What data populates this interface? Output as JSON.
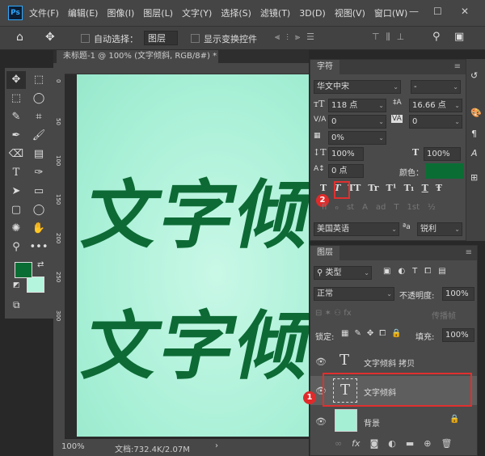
{
  "app": {
    "logo": "Ps"
  },
  "menu": [
    "文件(F)",
    "编辑(E)",
    "图像(I)",
    "图层(L)",
    "文字(Y)",
    "选择(S)",
    "滤镜(T)",
    "3D(D)",
    "视图(V)",
    "窗口(W)"
  ],
  "window_controls": {
    "minimize": "—",
    "maximize": "☐",
    "close": "✕"
  },
  "options": {
    "auto_select_label": "自动选择：",
    "auto_select_value": "图层",
    "show_transform_label": "显示变换控件"
  },
  "document": {
    "tab_title": "未标题-1 @ 100% (文字倾斜, RGB/8#) *",
    "close": "×",
    "canvas_text_1": "文字倾",
    "canvas_text_2": "文字倾",
    "text_color": "#0d6a35",
    "canvas_color": "#a5efd5"
  },
  "rulers": {
    "vertical": [
      "0",
      "50",
      "100",
      "150",
      "200",
      "250",
      "300"
    ]
  },
  "status": {
    "zoom": "100%",
    "doc_info": "文档:732.4K/2.07M",
    "arrow": "›"
  },
  "colors": {
    "foreground": "#0a6e34",
    "background": "#b4f5dd"
  },
  "character_panel": {
    "title": "字符",
    "font_family": "华文中宋",
    "font_style": "-",
    "font_size": "118 点",
    "leading": "16.66 点",
    "kerning": "0",
    "tracking": "0",
    "tsume": "0%",
    "vertical_scale": "100%",
    "horizontal_scale": "100%",
    "baseline_shift": "0 点",
    "color_label": "颜色：",
    "color": "#0a6e34",
    "style_buttons": [
      "T",
      "T",
      "TT",
      "Tr",
      "T¹",
      "T₁",
      "T",
      "Ŧ"
    ],
    "opentype_buttons": [
      "fi",
      "ℴ",
      "st",
      "A",
      "ad",
      "T",
      "1st",
      "½"
    ],
    "language": "美国英语",
    "aa_icon": "ªa",
    "antialias": "锐利"
  },
  "layers_panel": {
    "title": "图层",
    "filter_type": "类型",
    "blend_mode": "正常",
    "opacity_label": "不透明度:",
    "opacity": "100%",
    "lock_label": "锁定:",
    "fill_label": "填充:",
    "fill": "100%",
    "propagate": "传播帧",
    "layers": [
      {
        "name": "文字倾斜 拷贝",
        "type": "text"
      },
      {
        "name": "文字倾斜",
        "type": "text",
        "selected": true
      },
      {
        "name": "背景",
        "type": "image"
      }
    ],
    "footer_icons": [
      "link",
      "fx",
      "mask",
      "adjustment",
      "group",
      "new-layer",
      "delete"
    ]
  },
  "annotations": {
    "badge_1": "1",
    "badge_2": "2",
    "highlight_color": "#e03030"
  }
}
